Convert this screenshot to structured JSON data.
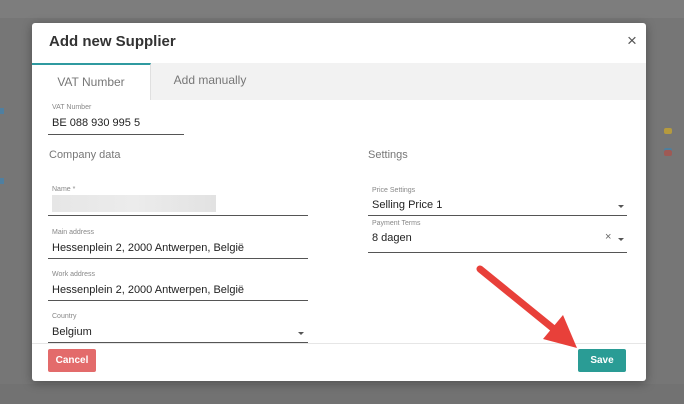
{
  "modal": {
    "title": "Add new Supplier",
    "close_label": "×"
  },
  "tabs": [
    {
      "label": "VAT Number",
      "active": true
    },
    {
      "label": "Add manually",
      "active": false
    }
  ],
  "vat": {
    "label": "VAT Number",
    "value": "BE 088 930 995 5"
  },
  "company": {
    "section_title": "Company data",
    "name_label": "Name *",
    "name_value": "",
    "main_address_label": "Main address",
    "main_address_value": "Hessenplein 2, 2000 Antwerpen, België",
    "work_address_label": "Work address",
    "work_address_value": "Hessenplein 2, 2000 Antwerpen, België",
    "country_label": "Country",
    "country_value": "Belgium"
  },
  "settings": {
    "section_title": "Settings",
    "price_label": "Price Settings",
    "price_value": "Selling Price 1",
    "payment_label": "Payment Terms",
    "payment_value": "8 dagen",
    "clear_label": "×"
  },
  "footer": {
    "cancel_label": "Cancel",
    "save_label": "Save"
  },
  "colors": {
    "accent": "#2a9c95",
    "cancel": "#e36b6b",
    "arrow": "#e8403a",
    "overlay": "#767676"
  },
  "icons": {
    "close": "close-icon",
    "dropdown": "caret-down-icon",
    "clear": "clear-icon",
    "annotation": "red-arrow-icon"
  }
}
